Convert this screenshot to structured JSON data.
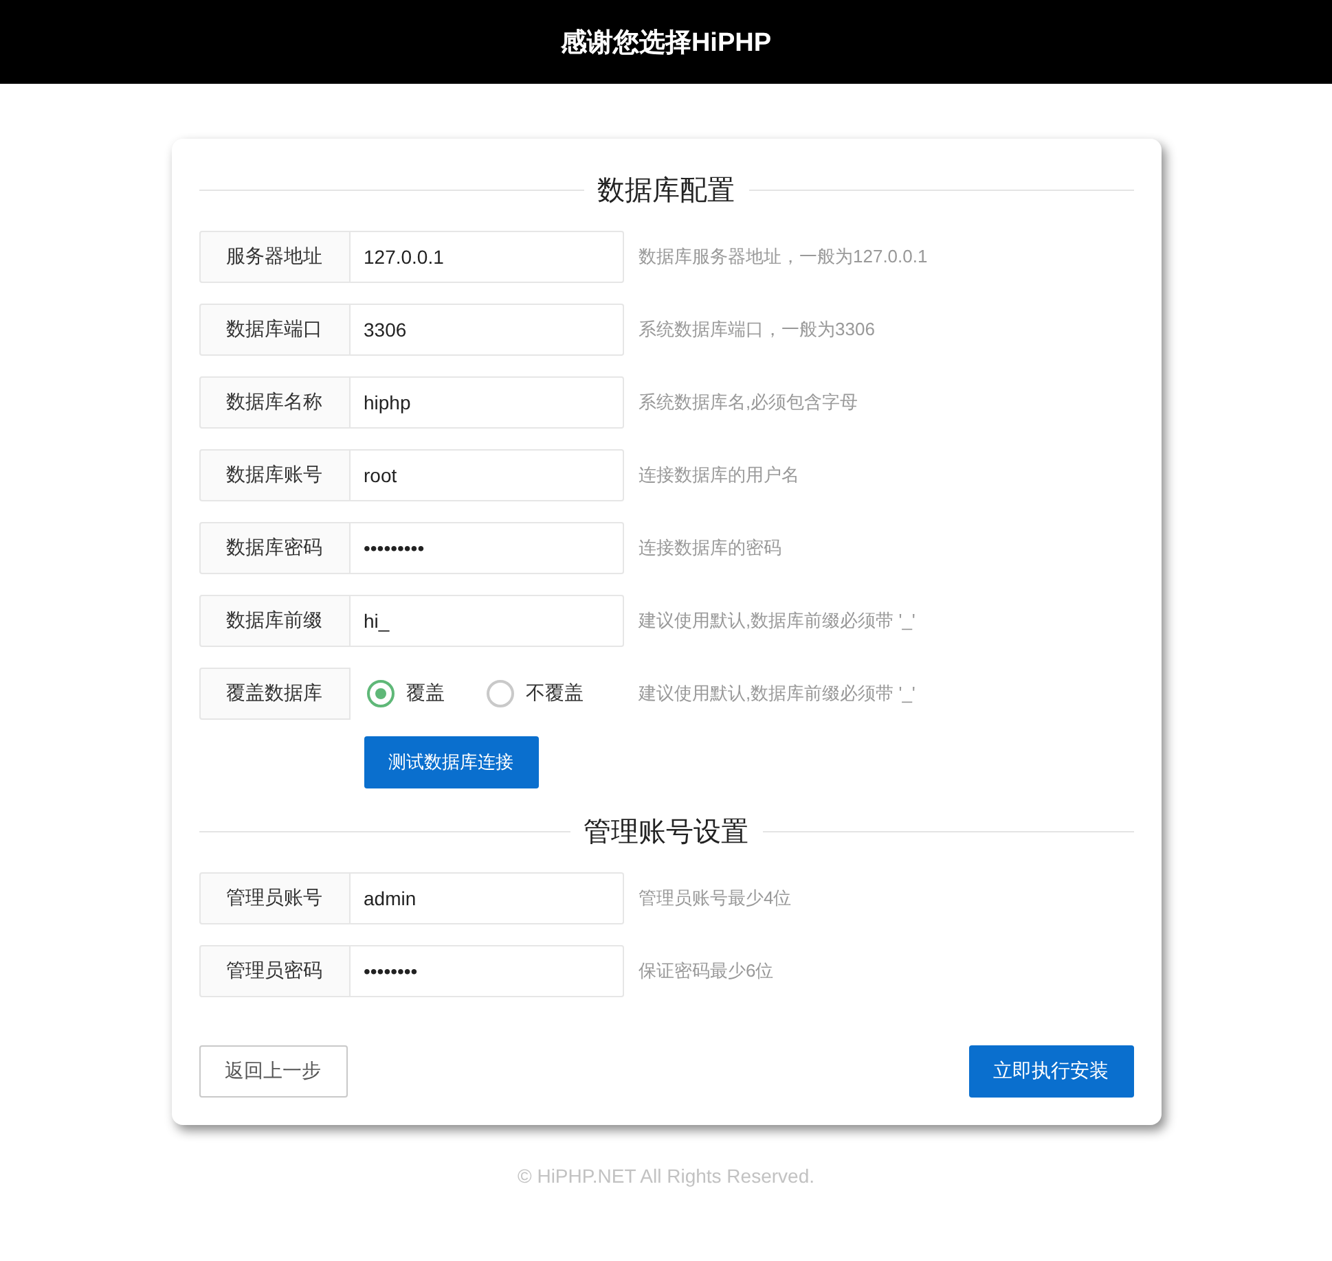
{
  "header": {
    "title": "感谢您选择HiPHP"
  },
  "sections": [
    {
      "title": "数据库配置",
      "rows": [
        {
          "kind": "input",
          "label": "服务器地址",
          "value": "127.0.0.1",
          "hint": "数据库服务器地址，一般为127.0.0.1"
        },
        {
          "kind": "input",
          "label": "数据库端口",
          "value": "3306",
          "hint": "系统数据库端口，一般为3306"
        },
        {
          "kind": "input",
          "label": "数据库名称",
          "value": "hiphp",
          "hint": "系统数据库名,必须包含字母"
        },
        {
          "kind": "input",
          "label": "数据库账号",
          "value": "root",
          "hint": "连接数据库的用户名"
        },
        {
          "kind": "input",
          "label": "数据库密码",
          "value": "•••••••••",
          "hint": "连接数据库的密码"
        },
        {
          "kind": "input",
          "label": "数据库前缀",
          "value": "hi_",
          "hint": "建议使用默认,数据库前缀必须带 '_'"
        },
        {
          "kind": "radio",
          "label": "覆盖数据库",
          "options": [
            {
              "label": "覆盖",
              "selected": true
            },
            {
              "label": "不覆盖",
              "selected": false
            }
          ],
          "hint": "建议使用默认,数据库前缀必须带 '_'"
        }
      ],
      "action": "测试数据库连接"
    },
    {
      "title": "管理账号设置",
      "rows": [
        {
          "kind": "input",
          "label": "管理员账号",
          "value": "admin",
          "hint": "管理员账号最少4位"
        },
        {
          "kind": "input",
          "label": "管理员密码",
          "value": "••••••••",
          "hint": "保证密码最少6位"
        }
      ]
    }
  ],
  "back_button": "返回上一步",
  "install_button": "立即执行安装",
  "footer": "© HiPHP.NET All Rights Reserved."
}
